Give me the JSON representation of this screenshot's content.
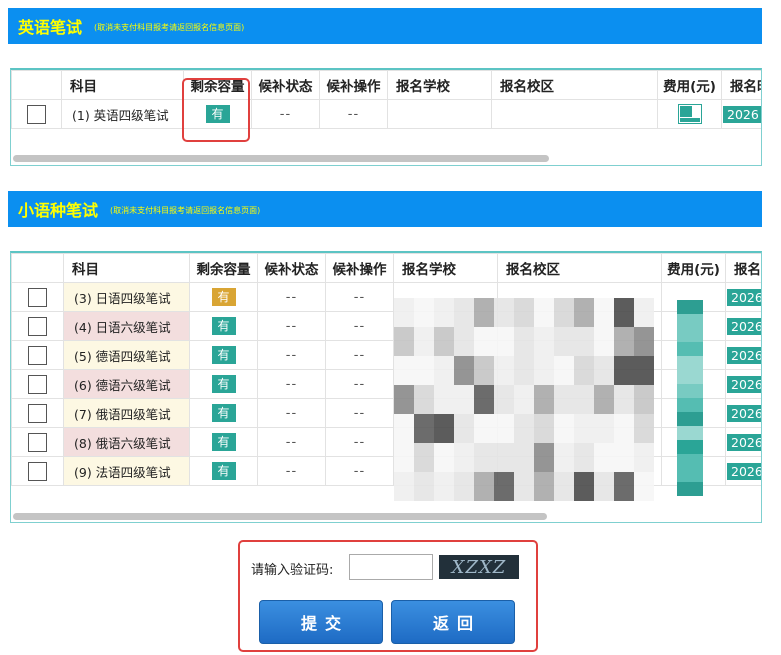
{
  "english": {
    "title": "英语笔试",
    "note": "(取消未支付科目报考请返回报名信息页面)",
    "headers": [
      "",
      "科目",
      "剩余容量",
      "候补状态",
      "候补操作",
      "报名学校",
      "报名校区",
      "费用(元)",
      "报名时"
    ],
    "rows": [
      {
        "subject": "(1) 英语四级笔试",
        "capacity": "有",
        "waitlist_status": "--",
        "waitlist_action": "--",
        "date": "2026"
      }
    ]
  },
  "minor": {
    "title": "小语种笔试",
    "note": "(取消未支付科目报考请返回报名信息页面)",
    "headers": [
      "",
      "科目",
      "剩余容量",
      "候补状态",
      "候补操作",
      "报名学校",
      "报名校区",
      "费用(元)",
      "报名时"
    ],
    "rows": [
      {
        "subject": "(3) 日语四级笔试",
        "capacity": "有",
        "waitlist_status": "--",
        "waitlist_action": "--",
        "date": "2026"
      },
      {
        "subject": "(4) 日语六级笔试",
        "capacity": "有",
        "waitlist_status": "--",
        "waitlist_action": "--",
        "date": "2026"
      },
      {
        "subject": "(5) 德语四级笔试",
        "capacity": "有",
        "waitlist_status": "--",
        "waitlist_action": "--",
        "date": "2026"
      },
      {
        "subject": "(6) 德语六级笔试",
        "capacity": "有",
        "waitlist_status": "--",
        "waitlist_action": "--",
        "date": "2026"
      },
      {
        "subject": "(7) 俄语四级笔试",
        "capacity": "有",
        "waitlist_status": "--",
        "waitlist_action": "--",
        "date": "2026"
      },
      {
        "subject": "(8) 俄语六级笔试",
        "capacity": "有",
        "waitlist_status": "--",
        "waitlist_action": "--",
        "date": "2026"
      },
      {
        "subject": "(9) 法语四级笔试",
        "capacity": "有",
        "waitlist_status": "--",
        "waitlist_action": "--",
        "date": "2026"
      }
    ]
  },
  "captcha": {
    "label": "请输入验证码:",
    "value": "",
    "image_text": "XZXZ"
  },
  "buttons": {
    "submit": "提交",
    "back": "返回"
  },
  "colors": {
    "header_bg": "#0b8ff0",
    "title": "#ffff00",
    "badge": "#2aa597",
    "badge_highlight": "#d9a534",
    "highlight_box": "#e0403e"
  }
}
